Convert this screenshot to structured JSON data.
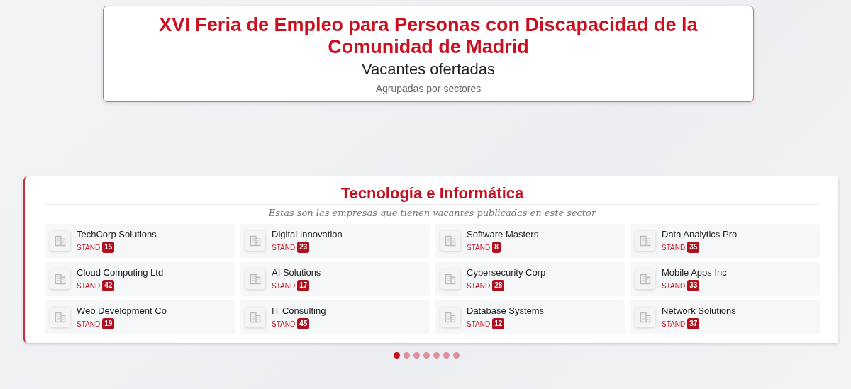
{
  "header": {
    "title": "XVI Feria de Empleo para Personas con Discapacidad de la Comunidad de Madrid",
    "subtitle": "Vacantes ofertadas",
    "caption": "Agrupadas por sectores"
  },
  "sector": {
    "title": "Tecnología e Informática",
    "description": "Estas son las empresas que tienen vacantes publicadas en este sector",
    "companies": [
      {
        "name": "TechCorp Solutions",
        "stand_label": "STAND",
        "stand": "15"
      },
      {
        "name": "Digital Innovation",
        "stand_label": "STAND",
        "stand": "23"
      },
      {
        "name": "Software Masters",
        "stand_label": "STAND",
        "stand": "8"
      },
      {
        "name": "Data Analytics Pro",
        "stand_label": "STAND",
        "stand": "35"
      },
      {
        "name": "Cloud Computing Ltd",
        "stand_label": "STAND",
        "stand": "42"
      },
      {
        "name": "AI Solutions",
        "stand_label": "STAND",
        "stand": "17"
      },
      {
        "name": "Cybersecurity Corp",
        "stand_label": "STAND",
        "stand": "28"
      },
      {
        "name": "Mobile Apps Inc",
        "stand_label": "STAND",
        "stand": "33"
      },
      {
        "name": "Web Development Co",
        "stand_label": "STAND",
        "stand": "19"
      },
      {
        "name": "IT Consulting",
        "stand_label": "STAND",
        "stand": "45"
      },
      {
        "name": "Database Systems",
        "stand_label": "STAND",
        "stand": "12"
      },
      {
        "name": "Network Solutions",
        "stand_label": "STAND",
        "stand": "37"
      }
    ]
  },
  "pager": [
    {
      "selected": true
    },
    {
      "selected": false
    },
    {
      "selected": false
    },
    {
      "selected": false
    },
    {
      "selected": false
    },
    {
      "selected": false
    },
    {
      "selected": false
    }
  ]
}
